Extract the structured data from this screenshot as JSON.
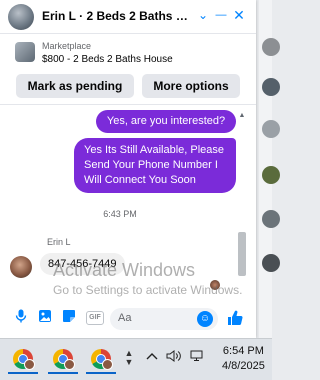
{
  "header": {
    "title": "Erin L · 2 Beds 2 Baths Hou...",
    "minimize_glyph": "—",
    "close_glyph": "✕",
    "chevron_glyph": "⌄"
  },
  "marketplace": {
    "kicker": "Marketplace",
    "listing": "$800 - 2 Beds 2 Baths House",
    "mark_pending_label": "Mark as pending",
    "more_options_label": "More options"
  },
  "messages": {
    "outgoing_1": "Yes, are you interested?",
    "outgoing_2": "Yes Its Still Available, Please Send Your Phone Number I Will Connect You Soon",
    "timestamp": "6:43 PM",
    "sender_name": "Erin L",
    "incoming_1": "847-456-7449"
  },
  "watermark": {
    "line1": "Activate Windows",
    "line2": "Go to Settings to activate Windows."
  },
  "composer": {
    "placeholder": "Aa",
    "gif_label": "GIF"
  },
  "taskbar": {
    "time": "6:54 PM",
    "date": "4/8/2025"
  },
  "icons": {
    "mic": "mic-icon",
    "photo": "photo-icon",
    "sticker": "sticker-icon",
    "emoji": "emoji-icon",
    "like": "thumbs-up-icon"
  },
  "colors": {
    "messenger_blue": "#0084ff",
    "outgoing_bubble": "#7b2bd9"
  }
}
